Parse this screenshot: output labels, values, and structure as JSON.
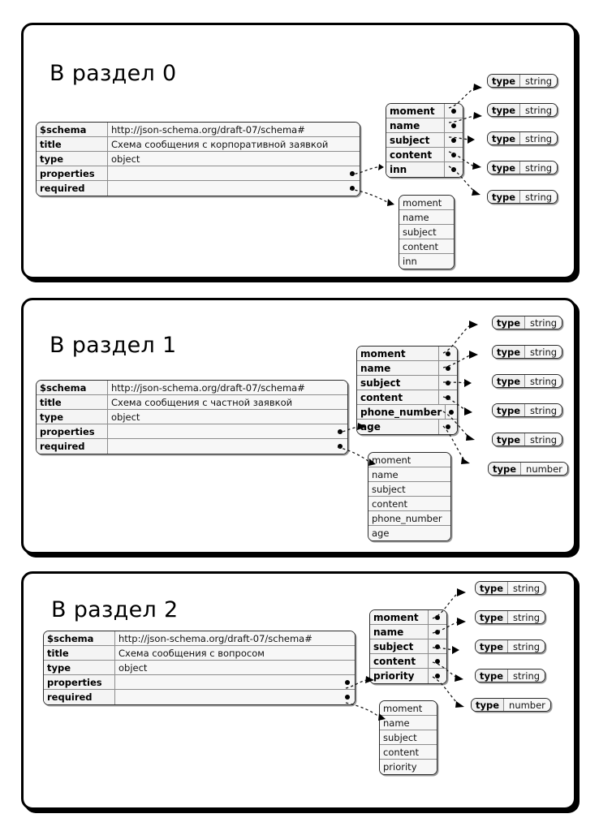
{
  "page": {
    "background": "#ffffff",
    "accent": "#000000",
    "box_fill": "#f2f2f2"
  },
  "panels": [
    {
      "title": "В раздел 0",
      "schema": {
        "rows": [
          {
            "key": "$schema",
            "value": "http://json-schema.org/draft-07/schema#",
            "ref": false
          },
          {
            "key": "title",
            "value": "Схема сообщения с корпоративной заявкой",
            "ref": false
          },
          {
            "key": "type",
            "value": "object",
            "ref": false
          },
          {
            "key": "properties",
            "value": "",
            "ref": true
          },
          {
            "key": "required",
            "value": "",
            "ref": true
          }
        ]
      },
      "properties": [
        {
          "name": "moment",
          "type_key": "type",
          "type_value": "string"
        },
        {
          "name": "name",
          "type_key": "type",
          "type_value": "string"
        },
        {
          "name": "subject",
          "type_key": "type",
          "type_value": "string"
        },
        {
          "name": "content",
          "type_key": "type",
          "type_value": "string"
        },
        {
          "name": "inn",
          "type_key": "type",
          "type_value": "string"
        }
      ],
      "required": [
        "moment",
        "name",
        "subject",
        "content",
        "inn"
      ]
    },
    {
      "title": "В раздел 1",
      "schema": {
        "rows": [
          {
            "key": "$schema",
            "value": "http://json-schema.org/draft-07/schema#",
            "ref": false
          },
          {
            "key": "title",
            "value": "Схема сообщения с частной заявкой",
            "ref": false
          },
          {
            "key": "type",
            "value": "object",
            "ref": false
          },
          {
            "key": "properties",
            "value": "",
            "ref": true
          },
          {
            "key": "required",
            "value": "",
            "ref": true
          }
        ]
      },
      "properties": [
        {
          "name": "moment",
          "type_key": "type",
          "type_value": "string"
        },
        {
          "name": "name",
          "type_key": "type",
          "type_value": "string"
        },
        {
          "name": "subject",
          "type_key": "type",
          "type_value": "string"
        },
        {
          "name": "content",
          "type_key": "type",
          "type_value": "string"
        },
        {
          "name": "phone_number",
          "type_key": "type",
          "type_value": "string"
        },
        {
          "name": "age",
          "type_key": "type",
          "type_value": "number"
        }
      ],
      "required": [
        "moment",
        "name",
        "subject",
        "content",
        "phone_number",
        "age"
      ]
    },
    {
      "title": "В раздел 2",
      "schema": {
        "rows": [
          {
            "key": "$schema",
            "value": "http://json-schema.org/draft-07/schema#",
            "ref": false
          },
          {
            "key": "title",
            "value": "Схема сообщения с вопросом",
            "ref": false
          },
          {
            "key": "type",
            "value": "object",
            "ref": false
          },
          {
            "key": "properties",
            "value": "",
            "ref": true
          },
          {
            "key": "required",
            "value": "",
            "ref": true
          }
        ]
      },
      "properties": [
        {
          "name": "moment",
          "type_key": "type",
          "type_value": "string"
        },
        {
          "name": "name",
          "type_key": "type",
          "type_value": "string"
        },
        {
          "name": "subject",
          "type_key": "type",
          "type_value": "string"
        },
        {
          "name": "content",
          "type_key": "type",
          "type_value": "string"
        },
        {
          "name": "priority",
          "type_key": "type",
          "type_value": "number"
        }
      ],
      "required": [
        "moment",
        "name",
        "subject",
        "content",
        "priority"
      ]
    }
  ]
}
